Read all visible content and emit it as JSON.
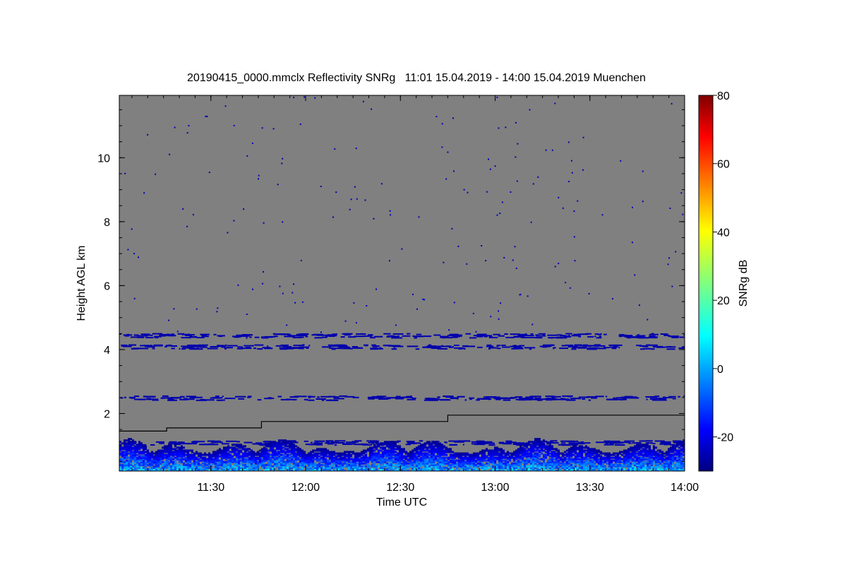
{
  "chart_data": {
    "type": "heatmap",
    "title": "20190415_0000.mmclx Reflectivity SNRg   11:01 15.04.2019 - 14:00 15.04.2019 Muenchen",
    "xlabel": "Time UTC",
    "ylabel": "Height AGL km",
    "colorbar_label": "SNRg dB",
    "xlim": [
      "11:01",
      "14:00"
    ],
    "ylim": [
      0.2,
      11.95
    ],
    "x_ticks": [
      "11:30",
      "12:00",
      "12:30",
      "13:00",
      "13:30",
      "14:00"
    ],
    "y_ticks": [
      2,
      4,
      6,
      8,
      10
    ],
    "colorbar_range": [
      -30,
      80
    ],
    "colorbar_ticks": [
      -20,
      0,
      20,
      40,
      60,
      80
    ],
    "colormap": "jet",
    "background_color": "#808080",
    "cloud_base_line": {
      "color": "#000000",
      "points": [
        {
          "time": "11:01",
          "height": 1.45
        },
        {
          "time": "11:16",
          "height": 1.45
        },
        {
          "time": "11:16",
          "height": 1.55
        },
        {
          "time": "11:46",
          "height": 1.55
        },
        {
          "time": "11:46",
          "height": 1.75
        },
        {
          "time": "12:45",
          "height": 1.75
        },
        {
          "time": "12:45",
          "height": 1.95
        },
        {
          "time": "14:00",
          "height": 1.95
        }
      ]
    },
    "echo_layers": [
      {
        "height": 4.45,
        "snr_db": -25
      },
      {
        "height": 4.1,
        "snr_db": -25
      },
      {
        "height": 2.5,
        "snr_db": -25
      },
      {
        "height": 1.1,
        "snr_db": -25
      },
      {
        "height_range": [
          0.2,
          1.2
        ],
        "snr_db_range": [
          -28,
          12
        ]
      }
    ]
  }
}
